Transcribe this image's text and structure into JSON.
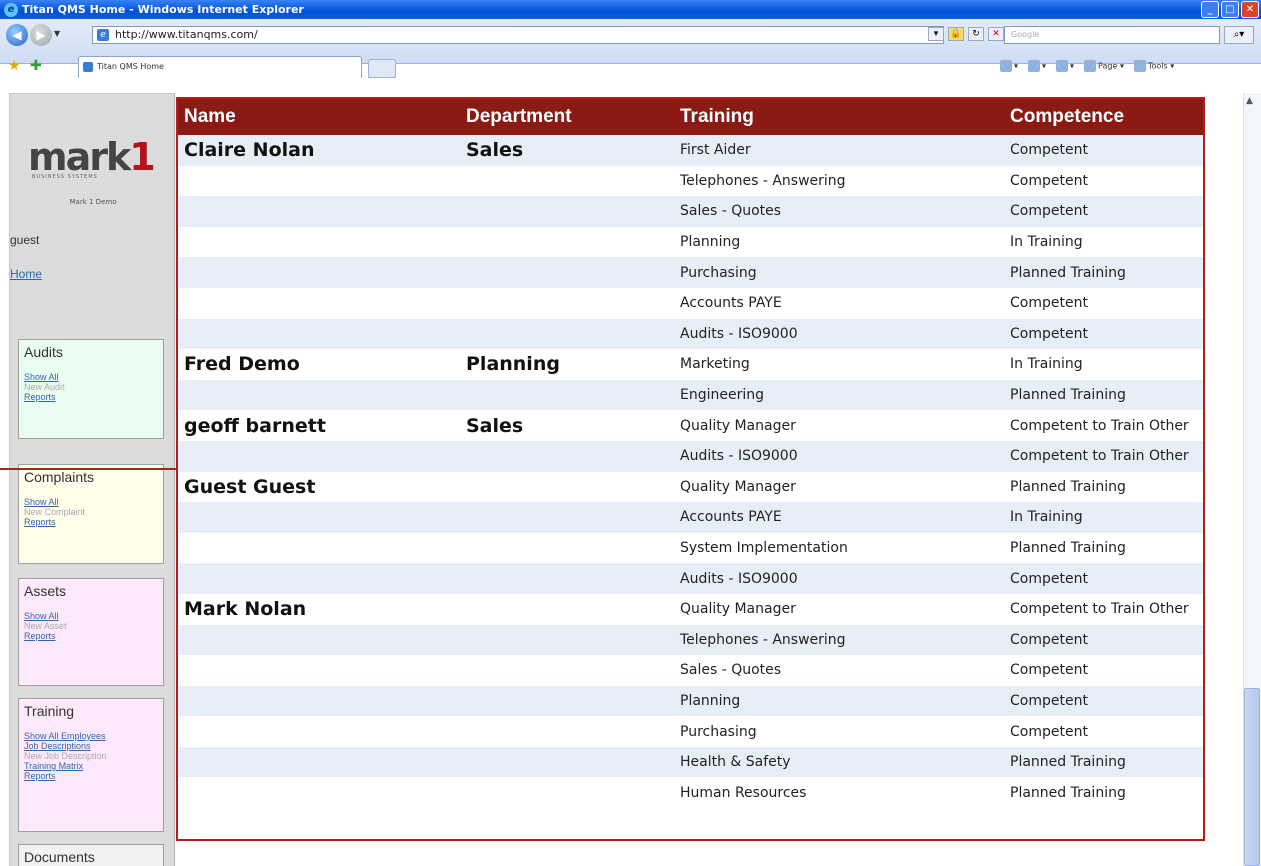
{
  "window": {
    "title": "Titan QMS Home - Windows Internet Explorer",
    "url": "http://www.titanqms.com/",
    "search_placeholder": "Google",
    "tab_title": "Titan QMS Home",
    "cmd_page": "Page",
    "cmd_tools": "Tools"
  },
  "sidebar": {
    "logo_text": "mark",
    "logo_one": "1",
    "logo_sub": "BUSINESS SYSTEMS",
    "demo_label": "Mark 1 Demo",
    "user": "guest",
    "home_link": "Home",
    "audits": {
      "title": "Audits",
      "show_all": "Show All",
      "new": "New Audit",
      "reports": "Reports"
    },
    "complaints": {
      "title": "Complaints",
      "show_all": "Show All",
      "new": "New Complaint",
      "reports": "Reports"
    },
    "assets": {
      "title": "Assets",
      "show_all": "Show All",
      "new": "New Asset",
      "reports": "Reports"
    },
    "training": {
      "title": "Training",
      "show_all_employees": "Show All Employees",
      "job_descriptions": "Job Descriptions",
      "new_job_description": "New Job Description",
      "training_matrix": "Training Matrix",
      "reports": "Reports"
    },
    "documents": {
      "title": "Documents"
    }
  },
  "table": {
    "headers": [
      "Name",
      "Department",
      "Training",
      "Competence"
    ],
    "rows": [
      [
        "Claire Nolan",
        "Sales",
        "First Aider",
        "Competent"
      ],
      [
        "",
        "",
        "Telephones - Answering",
        "Competent"
      ],
      [
        "",
        "",
        "Sales - Quotes",
        "Competent"
      ],
      [
        "",
        "",
        "Planning",
        "In Training"
      ],
      [
        "",
        "",
        "Purchasing",
        "Planned Training"
      ],
      [
        "",
        "",
        "Accounts PAYE",
        "Competent"
      ],
      [
        "",
        "",
        "Audits - ISO9000",
        "Competent"
      ],
      [
        "Fred Demo",
        "Planning",
        "Marketing",
        "In Training"
      ],
      [
        "",
        "",
        "Engineering",
        "Planned Training"
      ],
      [
        "geoff barnett",
        "Sales",
        "Quality Manager",
        "Competent to Train Other"
      ],
      [
        "",
        "",
        "Audits - ISO9000",
        "Competent to Train Other"
      ],
      [
        "Guest Guest",
        "",
        "Quality Manager",
        "Planned Training"
      ],
      [
        "",
        "",
        "Accounts PAYE",
        "In Training"
      ],
      [
        "",
        "",
        "System Implementation",
        "Planned Training"
      ],
      [
        "",
        "",
        "Audits - ISO9000",
        "Competent"
      ],
      [
        "Mark Nolan",
        "",
        "Quality Manager",
        "Competent to Train Other"
      ],
      [
        "",
        "",
        "Telephones - Answering",
        "Competent"
      ],
      [
        "",
        "",
        "Sales - Quotes",
        "Competent"
      ],
      [
        "",
        "",
        "Planning",
        "Competent"
      ],
      [
        "",
        "",
        "Purchasing",
        "Competent"
      ],
      [
        "",
        "",
        "Health & Safety",
        "Planned Training"
      ],
      [
        "",
        "",
        "Human Resources",
        "Planned Training"
      ]
    ]
  },
  "colors": {
    "header_bg": "#8b1a14",
    "table_border": "#b71c1c",
    "row_alt": "#e8eef8",
    "link": "#3366aa"
  }
}
